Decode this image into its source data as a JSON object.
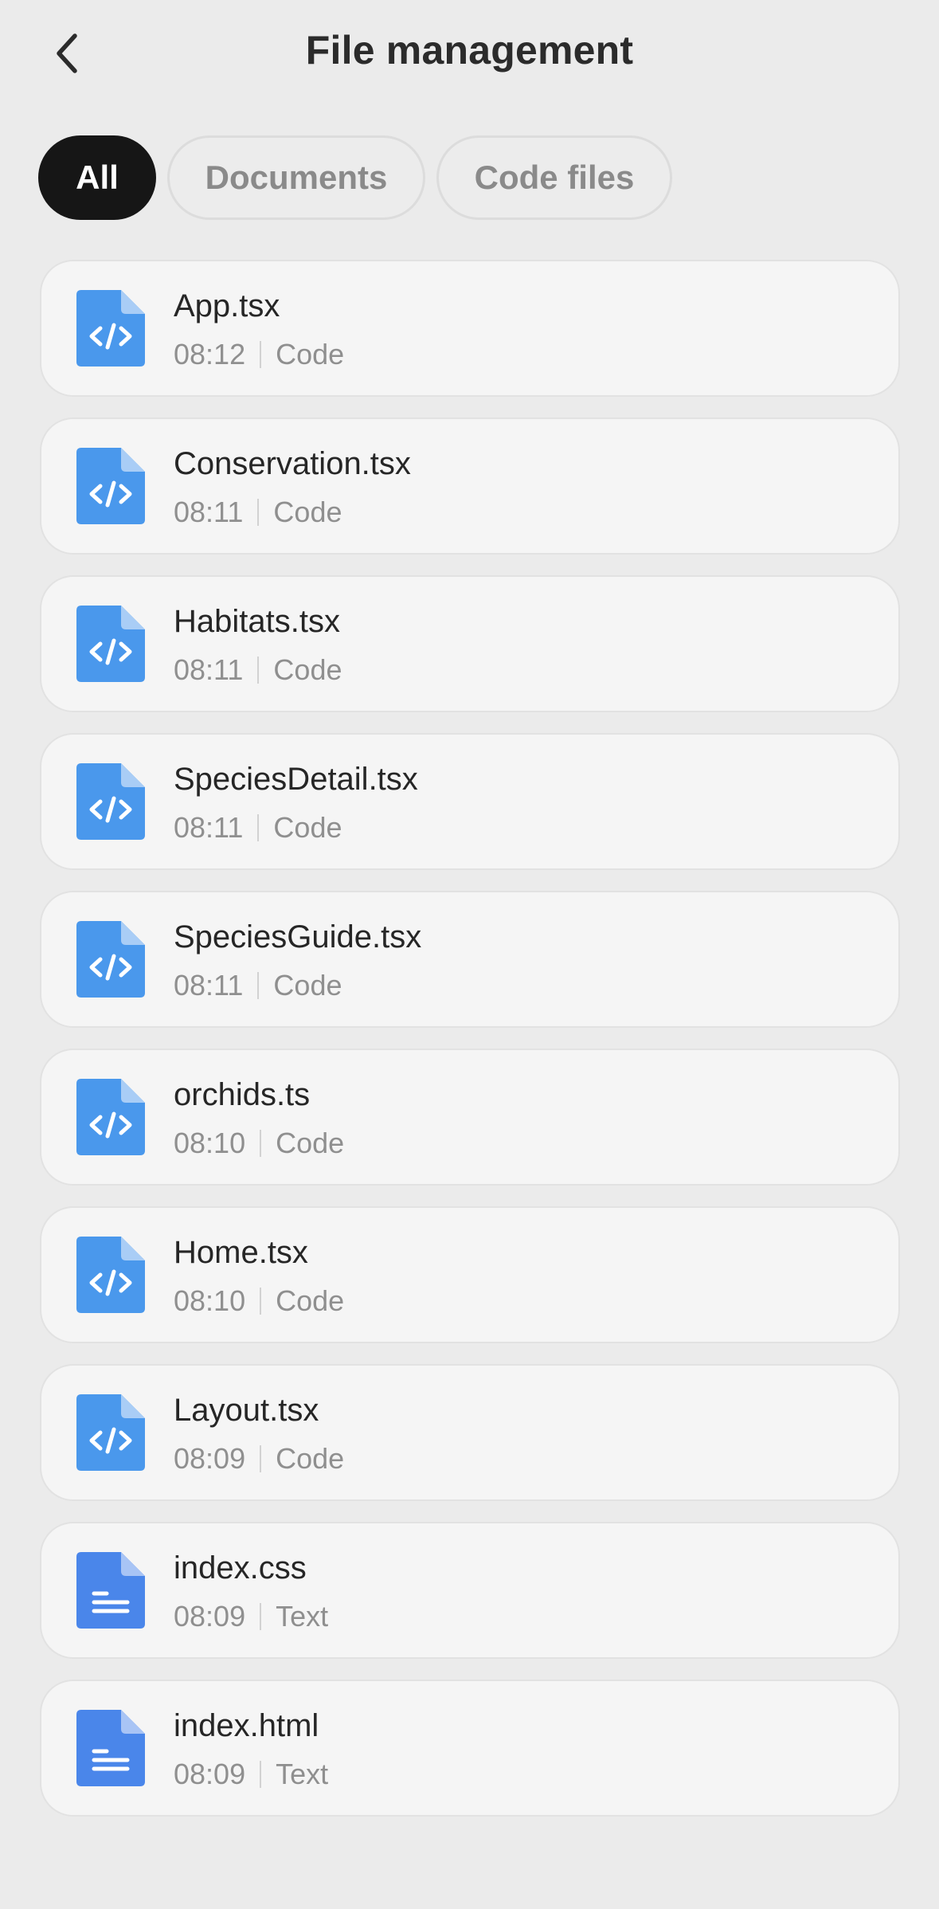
{
  "header": {
    "title": "File management"
  },
  "tabs": [
    {
      "label": "All",
      "active": true
    },
    {
      "label": "Documents",
      "active": false
    },
    {
      "label": "Code files",
      "active": false
    }
  ],
  "colors": {
    "code_icon": "#4a98ec",
    "text_icon": "#4a86ea",
    "active_tab": "#161616"
  },
  "files": [
    {
      "name": "App.tsx",
      "time": "08:12",
      "type": "Code",
      "icon": "code-file-icon"
    },
    {
      "name": "Conservation.tsx",
      "time": "08:11",
      "type": "Code",
      "icon": "code-file-icon"
    },
    {
      "name": "Habitats.tsx",
      "time": "08:11",
      "type": "Code",
      "icon": "code-file-icon"
    },
    {
      "name": "SpeciesDetail.tsx",
      "time": "08:11",
      "type": "Code",
      "icon": "code-file-icon"
    },
    {
      "name": "SpeciesGuide.tsx",
      "time": "08:11",
      "type": "Code",
      "icon": "code-file-icon"
    },
    {
      "name": "orchids.ts",
      "time": "08:10",
      "type": "Code",
      "icon": "code-file-icon"
    },
    {
      "name": "Home.tsx",
      "time": "08:10",
      "type": "Code",
      "icon": "code-file-icon"
    },
    {
      "name": "Layout.tsx",
      "time": "08:09",
      "type": "Code",
      "icon": "code-file-icon"
    },
    {
      "name": "index.css",
      "time": "08:09",
      "type": "Text",
      "icon": "text-file-icon"
    },
    {
      "name": "index.html",
      "time": "08:09",
      "type": "Text",
      "icon": "text-file-icon"
    }
  ]
}
